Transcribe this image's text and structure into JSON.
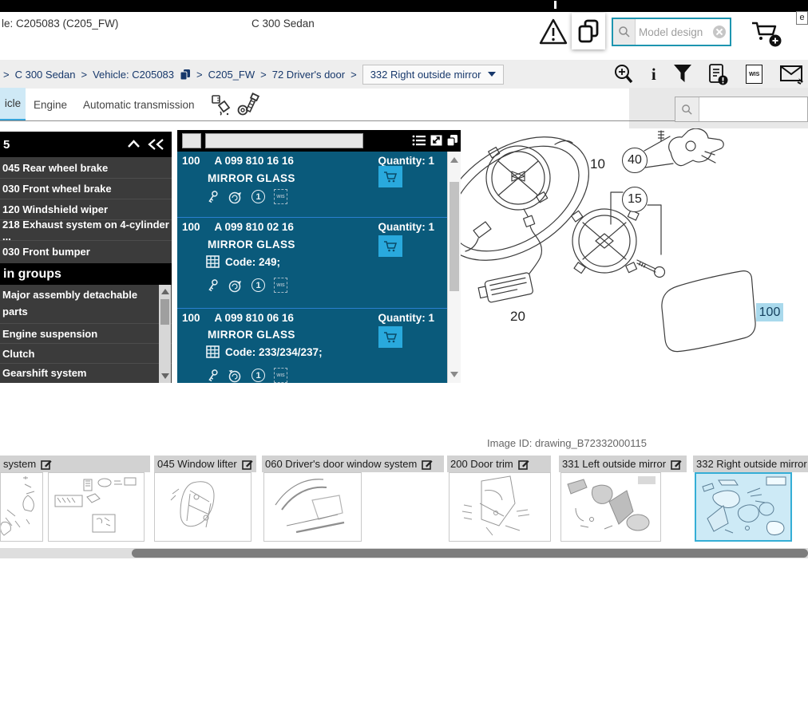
{
  "top": {
    "left_title": "le: C205083 (C205_FW)",
    "model_name": "C 300 Sedan",
    "edge_label": "e",
    "search_placeholder": "Model design"
  },
  "breadcrumb": {
    "separator": ">",
    "items": [
      "C 300 Sedan",
      "Vehicle: C205083",
      "C205_FW",
      "72 Driver's door"
    ],
    "current": "332 Right outside mirror"
  },
  "tabs": {
    "items": [
      {
        "label": "icle",
        "active": true
      },
      {
        "label": "Engine",
        "active": false
      },
      {
        "label": "Automatic transmission",
        "active": false
      }
    ]
  },
  "sidebar": {
    "history_header": "5",
    "history_items": [
      "045 Rear wheel brake",
      "030 Front wheel brake",
      "120 Windshield wiper",
      "218 Exhaust system on 4-cylinder ...",
      "030 Front bumper"
    ],
    "groups_header": "in groups",
    "group_items": [
      "Major assembly detachable parts",
      "Engine suspension",
      "Clutch",
      "Gearshift system"
    ]
  },
  "parts_panel": {
    "rows": [
      {
        "pos": "100",
        "part_number": "A 099 810 16 16",
        "name": "MIRROR GLASS",
        "quantity": "Quantity: 1",
        "code": ""
      },
      {
        "pos": "100",
        "part_number": "A 099 810 02 16",
        "name": "MIRROR GLASS",
        "quantity": "Quantity: 1",
        "code": "Code: 249;"
      },
      {
        "pos": "100",
        "part_number": "A 099 810 06 16",
        "name": "MIRROR GLASS",
        "quantity": "Quantity: 1",
        "code": "Code: 233/234/237;"
      }
    ]
  },
  "labels": {
    "wis": "WIS",
    "info_glyph": "i",
    "one_glyph": "1"
  },
  "drawing": {
    "callout_10": "10",
    "callout_40": "40",
    "callout_15": "15",
    "callout_20": "20",
    "callout_100": "100",
    "image_id": "Image ID: drawing_B72332000115",
    "highlight_color": "#a9d9ec"
  },
  "thumbnails": {
    "items": [
      {
        "label": "system",
        "selected": false
      },
      {
        "label": "045 Window lifter",
        "selected": false
      },
      {
        "label": "060 Driver's door window system",
        "selected": false
      },
      {
        "label": "200 Door trim",
        "selected": false
      },
      {
        "label": "331 Left outside mirror",
        "selected": false
      },
      {
        "label": "332 Right outside mirror",
        "selected": true
      }
    ]
  },
  "colors": {
    "accent_teal": "#1d95b0",
    "panel_blue": "#0a5a7b",
    "cart_cyan": "#29a9dd",
    "row_divider_blue": "#2a7fd0",
    "tab_active_bg": "#cfe9f6",
    "tab_active_underline": "#36a3d9",
    "selected_thumb_border": "#35aed6",
    "selected_thumb_bg": "#cdeaf6"
  }
}
